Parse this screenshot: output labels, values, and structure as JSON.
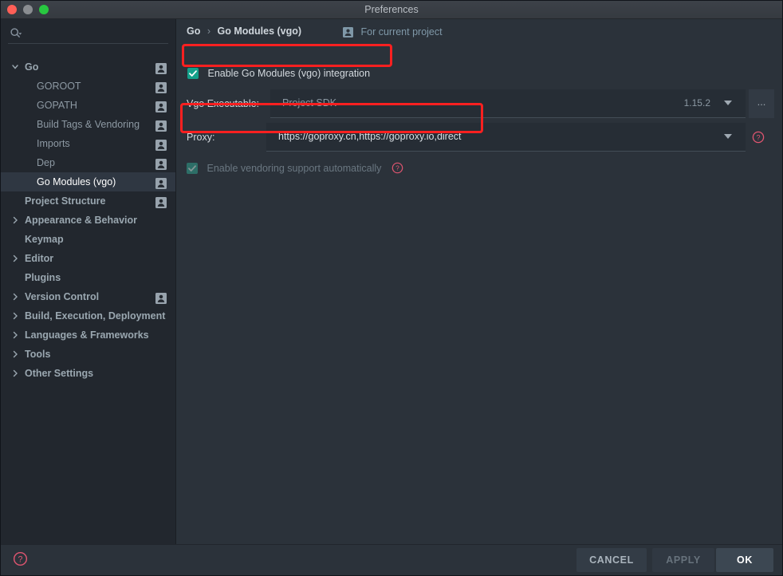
{
  "window": {
    "title": "Preferences",
    "controls": {
      "close": "close-button",
      "minimize": "minimize-button",
      "maximize": "maximize-button"
    }
  },
  "sidebar": {
    "search": {
      "placeholder": "",
      "value": "",
      "icon": "search-icon"
    },
    "items": [
      {
        "label": "Go",
        "level": 0,
        "caret": "down",
        "person": true,
        "selected": false
      },
      {
        "label": "GOROOT",
        "level": 1,
        "caret": "none",
        "person": true,
        "selected": false
      },
      {
        "label": "GOPATH",
        "level": 1,
        "caret": "none",
        "person": true,
        "selected": false
      },
      {
        "label": "Build Tags & Vendoring",
        "level": 1,
        "caret": "none",
        "person": true,
        "selected": false
      },
      {
        "label": "Imports",
        "level": 1,
        "caret": "none",
        "person": true,
        "selected": false
      },
      {
        "label": "Dep",
        "level": 1,
        "caret": "none",
        "person": true,
        "selected": false
      },
      {
        "label": "Go Modules (vgo)",
        "level": 1,
        "caret": "none",
        "person": true,
        "selected": true
      },
      {
        "label": "Project Structure",
        "level": 0,
        "caret": "none",
        "person": true,
        "selected": false
      },
      {
        "label": "Appearance & Behavior",
        "level": 0,
        "caret": "right",
        "person": false,
        "selected": false
      },
      {
        "label": "Keymap",
        "level": 0,
        "caret": "none",
        "person": false,
        "selected": false
      },
      {
        "label": "Editor",
        "level": 0,
        "caret": "right",
        "person": false,
        "selected": false
      },
      {
        "label": "Plugins",
        "level": 0,
        "caret": "none",
        "person": false,
        "selected": false
      },
      {
        "label": "Version Control",
        "level": 0,
        "caret": "right",
        "person": true,
        "selected": false
      },
      {
        "label": "Build, Execution, Deployment",
        "level": 0,
        "caret": "right",
        "person": false,
        "selected": false
      },
      {
        "label": "Languages & Frameworks",
        "level": 0,
        "caret": "right",
        "person": false,
        "selected": false
      },
      {
        "label": "Tools",
        "level": 0,
        "caret": "right",
        "person": false,
        "selected": false
      },
      {
        "label": "Other Settings",
        "level": 0,
        "caret": "right",
        "person": false,
        "selected": false
      }
    ]
  },
  "main": {
    "breadcrumb": {
      "root": "Go",
      "separator": "›",
      "current": "Go Modules (vgo)"
    },
    "scope": {
      "label": "For current project",
      "icon": "person-icon"
    },
    "enable_modules": {
      "label": "Enable Go Modules (vgo) integration",
      "checked": true
    },
    "vgo_executable": {
      "label": "Vgo Executable:",
      "value": "Project SDK",
      "version": "1.15.2",
      "browse_label": "...",
      "dropdown_icon": "chevron-down-icon"
    },
    "proxy": {
      "label": "Proxy:",
      "value": "https://goproxy.cn,https://goproxy.io,direct",
      "dropdown_icon": "chevron-down-icon",
      "help_icon": "help-circle-icon"
    },
    "vendoring": {
      "label": "Enable vendoring support automatically",
      "checked": true,
      "enabled": false,
      "help_icon": "help-circle-icon"
    }
  },
  "annotations": {
    "color": "#fb2020",
    "boxes": [
      {
        "target": "enable-go-modules-checkbox"
      },
      {
        "target": "proxy-field"
      }
    ]
  },
  "footer": {
    "help_icon": "help-circle-icon",
    "cancel_label": "CANCEL",
    "apply_label": "APPLY",
    "ok_label": "OK"
  }
}
